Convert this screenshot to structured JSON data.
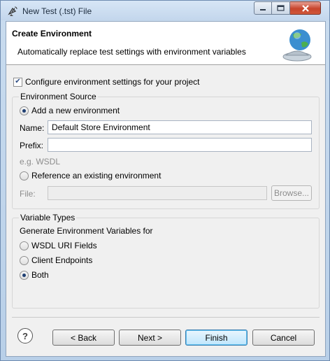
{
  "window": {
    "title": "New Test (.tst) File",
    "title_icon": "satellite-dish-icon"
  },
  "header": {
    "title": "Create Environment",
    "description": "Automatically replace test settings with environment variables",
    "icon": "globe-environment-icon"
  },
  "configure": {
    "label": "Configure environment settings for your project",
    "checked": true
  },
  "environment_source": {
    "group_title": "Environment Source",
    "add_new_label": "Add a new environment",
    "add_new_selected": true,
    "name_label": "Name:",
    "name_value": "Default Store Environment",
    "prefix_label": "Prefix:",
    "prefix_value": "",
    "prefix_hint": "e.g. WSDL",
    "reference_label": "Reference an existing environment",
    "reference_selected": false,
    "file_label": "File:",
    "file_value": "",
    "browse_label": "Browse..."
  },
  "variable_types": {
    "group_title": "Variable Types",
    "intro": "Generate Environment Variables for",
    "options": [
      {
        "label": "WSDL URI Fields",
        "selected": false
      },
      {
        "label": "Client Endpoints",
        "selected": false
      },
      {
        "label": "Both",
        "selected": true
      }
    ]
  },
  "footer": {
    "help_symbol": "?",
    "back_label": "< Back",
    "next_label": "Next >",
    "finish_label": "Finish",
    "cancel_label": "Cancel"
  },
  "colors": {
    "titlebar": "#c3d6ec",
    "close_button": "#c7452c",
    "default_button": "#62c0ef"
  }
}
